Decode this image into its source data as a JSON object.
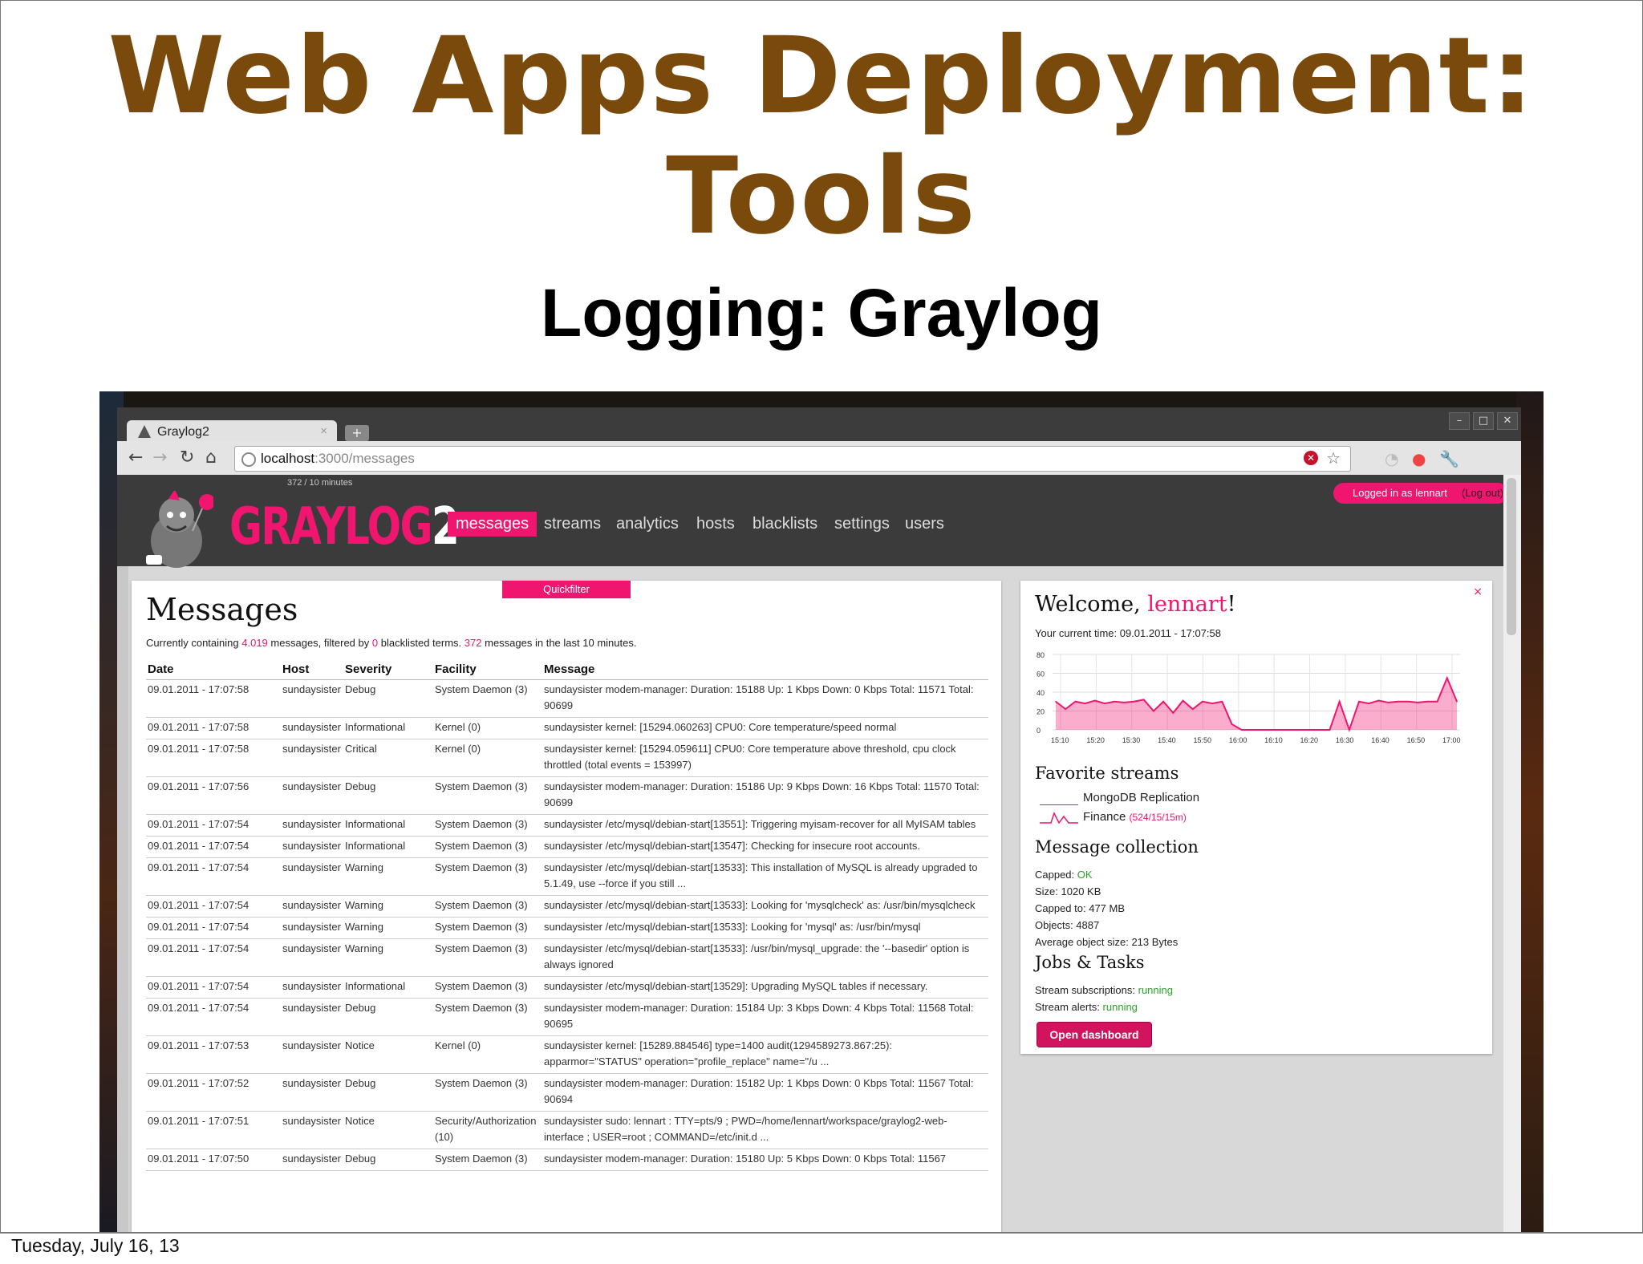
{
  "slide": {
    "title_line1": "Web Apps Deployment:",
    "title_line2": "Tools",
    "subtitle": "Logging: Graylog",
    "footer_date": "Tuesday, July 16, 13"
  },
  "browser": {
    "tab_title": "Graylog2",
    "tab_close": "×",
    "new_tab": "+",
    "url_host": "localhost",
    "url_path": ":3000/messages",
    "window_buttons": [
      "–",
      "□",
      "✕"
    ]
  },
  "graylog": {
    "logo_text": "GRAYLOG",
    "logo_num": "2",
    "msg_count": "372 / 10 minutes",
    "nav": [
      "messages",
      "streams",
      "analytics",
      "hosts",
      "blacklists",
      "settings",
      "users"
    ],
    "active_nav": "messages",
    "login_text": "Logged in as lennart",
    "logout_text": "(Log out)",
    "accent": "#f0156f"
  },
  "messages": {
    "quickfilter": "Quickfilter",
    "heading": "Messages",
    "summary": {
      "prefix": "Currently containing",
      "count": "4.019",
      "mid1": "messages, filtered by",
      "blacklisted": "0",
      "mid2": "blacklisted terms.",
      "recent": "372",
      "suffix": "messages in the last 10 minutes."
    },
    "columns": [
      "Date",
      "Host",
      "Severity",
      "Facility",
      "Message"
    ],
    "rows": [
      {
        "date": "09.01.2011 - 17:07:58",
        "host": "sundaysister",
        "severity": "Debug",
        "facility": "System Daemon (3)",
        "message": "sundaysister modem-manager: Duration: 15188 Up: 1 Kbps Down: 0 Kbps Total: 11571 Total: 90699"
      },
      {
        "date": "09.01.2011 - 17:07:58",
        "host": "sundaysister",
        "severity": "Informational",
        "facility": "Kernel (0)",
        "message": "sundaysister kernel: [15294.060263] CPU0: Core temperature/speed normal"
      },
      {
        "date": "09.01.2011 - 17:07:58",
        "host": "sundaysister",
        "severity": "Critical",
        "facility": "Kernel (0)",
        "message": "sundaysister kernel: [15294.059611] CPU0: Core temperature above threshold, cpu clock throttled (total events = 153997)"
      },
      {
        "date": "09.01.2011 - 17:07:56",
        "host": "sundaysister",
        "severity": "Debug",
        "facility": "System Daemon (3)",
        "message": "sundaysister modem-manager: Duration: 15186 Up: 9 Kbps Down: 16 Kbps Total: 11570 Total: 90699"
      },
      {
        "date": "09.01.2011 - 17:07:54",
        "host": "sundaysister",
        "severity": "Informational",
        "facility": "System Daemon (3)",
        "message": "sundaysister /etc/mysql/debian-start[13551]: Triggering myisam-recover for all MyISAM tables"
      },
      {
        "date": "09.01.2011 - 17:07:54",
        "host": "sundaysister",
        "severity": "Informational",
        "facility": "System Daemon (3)",
        "message": "sundaysister /etc/mysql/debian-start[13547]: Checking for insecure root accounts."
      },
      {
        "date": "09.01.2011 - 17:07:54",
        "host": "sundaysister",
        "severity": "Warning",
        "facility": "System Daemon (3)",
        "message": "sundaysister /etc/mysql/debian-start[13533]: This installation of MySQL is already upgraded to 5.1.49, use --force if you still ..."
      },
      {
        "date": "09.01.2011 - 17:07:54",
        "host": "sundaysister",
        "severity": "Warning",
        "facility": "System Daemon (3)",
        "message": "sundaysister /etc/mysql/debian-start[13533]: Looking for 'mysqlcheck' as: /usr/bin/mysqlcheck"
      },
      {
        "date": "09.01.2011 - 17:07:54",
        "host": "sundaysister",
        "severity": "Warning",
        "facility": "System Daemon (3)",
        "message": "sundaysister /etc/mysql/debian-start[13533]: Looking for 'mysql' as: /usr/bin/mysql"
      },
      {
        "date": "09.01.2011 - 17:07:54",
        "host": "sundaysister",
        "severity": "Warning",
        "facility": "System Daemon (3)",
        "message": "sundaysister /etc/mysql/debian-start[13533]: /usr/bin/mysql_upgrade: the '--basedir' option is always ignored"
      },
      {
        "date": "09.01.2011 - 17:07:54",
        "host": "sundaysister",
        "severity": "Informational",
        "facility": "System Daemon (3)",
        "message": "sundaysister /etc/mysql/debian-start[13529]: Upgrading MySQL tables if necessary."
      },
      {
        "date": "09.01.2011 - 17:07:54",
        "host": "sundaysister",
        "severity": "Debug",
        "facility": "System Daemon (3)",
        "message": "sundaysister modem-manager: Duration: 15184 Up: 3 Kbps Down: 4 Kbps Total: 11568 Total: 90695"
      },
      {
        "date": "09.01.2011 - 17:07:53",
        "host": "sundaysister",
        "severity": "Notice",
        "facility": "Kernel (0)",
        "message": "sundaysister kernel: [15289.884546] type=1400 audit(1294589273.867:25): apparmor=\"STATUS\" operation=\"profile_replace\" name=\"/u ..."
      },
      {
        "date": "09.01.2011 - 17:07:52",
        "host": "sundaysister",
        "severity": "Debug",
        "facility": "System Daemon (3)",
        "message": "sundaysister modem-manager: Duration: 15182 Up: 1 Kbps Down: 0 Kbps Total: 11567 Total: 90694"
      },
      {
        "date": "09.01.2011 - 17:07:51",
        "host": "sundaysister",
        "severity": "Notice",
        "facility": "Security/Authorization (10)",
        "message": "sundaysister sudo: lennart : TTY=pts/9 ; PWD=/home/lennart/workspace/graylog2-web-interface ; USER=root ; COMMAND=/etc/init.d ..."
      },
      {
        "date": "09.01.2011 - 17:07:50",
        "host": "sundaysister",
        "severity": "Debug",
        "facility": "System Daemon (3)",
        "message": "sundaysister modem-manager: Duration: 15180 Up: 5 Kbps Down: 0 Kbps Total: 11567"
      }
    ]
  },
  "welcome": {
    "close": "×",
    "heading_prefix": "Welcome,",
    "user": "lennart",
    "heading_suffix": "!",
    "current_time": "Your current time: 09.01.2011 - 17:07:58",
    "fav_heading": "Favorite streams",
    "streams": [
      {
        "name": "MongoDB Replication",
        "stats": ""
      },
      {
        "name": "Finance",
        "stats": "(524/15/15m)"
      }
    ],
    "collection_heading": "Message collection",
    "collection": {
      "capped_label": "Capped:",
      "capped_value": "OK",
      "size": "Size: 1020 KB",
      "capped_to": "Capped to: 477 MB",
      "objects": "Objects: 4887",
      "avg": "Average object size: 213 Bytes"
    },
    "jobs_heading": "Jobs & Tasks",
    "jobs": [
      {
        "label": "Stream subscriptions:",
        "status": "running"
      },
      {
        "label": "Stream alerts:",
        "status": "running"
      }
    ],
    "dashboard_button": "Open dashboard"
  },
  "chart_data": {
    "type": "area",
    "title": "",
    "xlabel": "",
    "ylabel": "",
    "ylim": [
      0,
      80
    ],
    "yticks": [
      "80",
      "60",
      "40",
      "20",
      "0"
    ],
    "categories": [
      "15:10",
      "15:20",
      "15:30",
      "15:40",
      "15:50",
      "16:00",
      "16:10",
      "16:20",
      "16:30",
      "16:40",
      "16:50",
      "17:00"
    ],
    "x_minutes_approx": [
      0,
      3,
      6,
      9,
      12,
      15,
      18,
      21,
      24,
      27,
      30,
      33,
      36,
      39,
      42,
      45,
      48,
      51,
      54,
      57,
      60,
      63,
      66,
      69,
      72,
      75,
      78,
      81,
      84,
      87,
      90,
      93,
      96,
      99,
      102,
      105,
      108,
      111,
      114,
      117,
      120,
      123
    ],
    "values": [
      30,
      22,
      30,
      28,
      31,
      28,
      30,
      29,
      30,
      32,
      20,
      30,
      18,
      31,
      22,
      30,
      28,
      30,
      6,
      0,
      0,
      0,
      0,
      0,
      0,
      0,
      0,
      0,
      0,
      30,
      0,
      30,
      28,
      31,
      29,
      30,
      30,
      29,
      30,
      30,
      55,
      30
    ],
    "color": "#f0156f",
    "grid": true
  }
}
